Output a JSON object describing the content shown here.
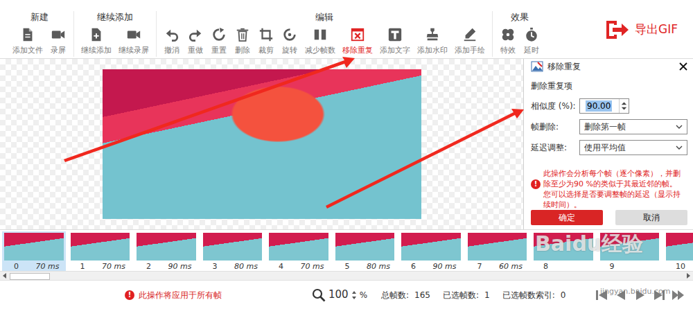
{
  "toolbar": {
    "groups": [
      {
        "title": "新建",
        "items": [
          {
            "label": "添加文件",
            "selected": false
          },
          {
            "label": "录屏",
            "selected": false
          }
        ]
      },
      {
        "title": "继续添加",
        "items": [
          {
            "label": "继续添加",
            "selected": false
          },
          {
            "label": "继续录屏",
            "selected": false
          }
        ]
      },
      {
        "title": "编辑",
        "items": [
          {
            "label": "撤消",
            "selected": false
          },
          {
            "label": "重做",
            "selected": false
          },
          {
            "label": "重置",
            "selected": false
          },
          {
            "label": "删除",
            "selected": false
          },
          {
            "label": "裁剪",
            "selected": false
          },
          {
            "label": "旋转",
            "selected": false
          },
          {
            "label": "减少帧数",
            "selected": false
          },
          {
            "label": "移除重复",
            "selected": true
          },
          {
            "label": "添加文字",
            "selected": false
          },
          {
            "label": "添加水印",
            "selected": false
          },
          {
            "label": "添加手绘",
            "selected": false
          }
        ]
      },
      {
        "title": "效果",
        "items": [
          {
            "label": "特效",
            "selected": false
          },
          {
            "label": "延时",
            "selected": false
          }
        ]
      }
    ],
    "export": {
      "label": "导出GIF"
    }
  },
  "dialog": {
    "title": "移除重复",
    "section": "删除重复项",
    "fields": [
      {
        "label": "相似度 (%):",
        "kind": "number",
        "value": "90.00",
        "highlighted": true
      },
      {
        "label": "帧删除:",
        "kind": "select",
        "value": "删除第一帧",
        "highlighted": false
      },
      {
        "label": "延迟调整:",
        "kind": "select",
        "value": "使用平均值",
        "highlighted": false
      }
    ],
    "info_icon": "!",
    "info": [
      "此操作会分析每个帧（逐个像素），并删除至少为90 %的类似于其最近邻的帧。",
      "您可以选择是否要调整帧的延迟（显示持续时间）。"
    ],
    "buttons": [
      {
        "label": "确定",
        "primary": true
      },
      {
        "label": "取消",
        "primary": false
      }
    ]
  },
  "frames": [
    {
      "index": "0",
      "delay": "70 ms",
      "selected": true
    },
    {
      "index": "1",
      "delay": "70 ms",
      "selected": false
    },
    {
      "index": "2",
      "delay": "90 ms",
      "selected": false
    },
    {
      "index": "3",
      "delay": "80 ms",
      "selected": false
    },
    {
      "index": "4",
      "delay": "70 ms",
      "selected": false
    },
    {
      "index": "5",
      "delay": "80 ms",
      "selected": false
    },
    {
      "index": "6",
      "delay": "90 ms",
      "selected": false
    },
    {
      "index": "7",
      "delay": "60 ms",
      "selected": false
    },
    {
      "index": "8",
      "selected": false
    },
    {
      "index": "9",
      "selected": false
    },
    {
      "index": "10",
      "selected": false
    }
  ],
  "status_bar": {
    "notice_icon": "!",
    "notice": "此操作将应用于所有帧",
    "zoom": "100",
    "zoom_unit": "%",
    "stats": [
      {
        "label": "总帧数:",
        "value": "165"
      },
      {
        "label": "已选帧数:",
        "value": "1"
      },
      {
        "label": "已选帧数索引:",
        "value": "0"
      }
    ]
  },
  "watermark": {
    "logo": "Baidu经验",
    "url": "jingyan.baidu.com"
  }
}
